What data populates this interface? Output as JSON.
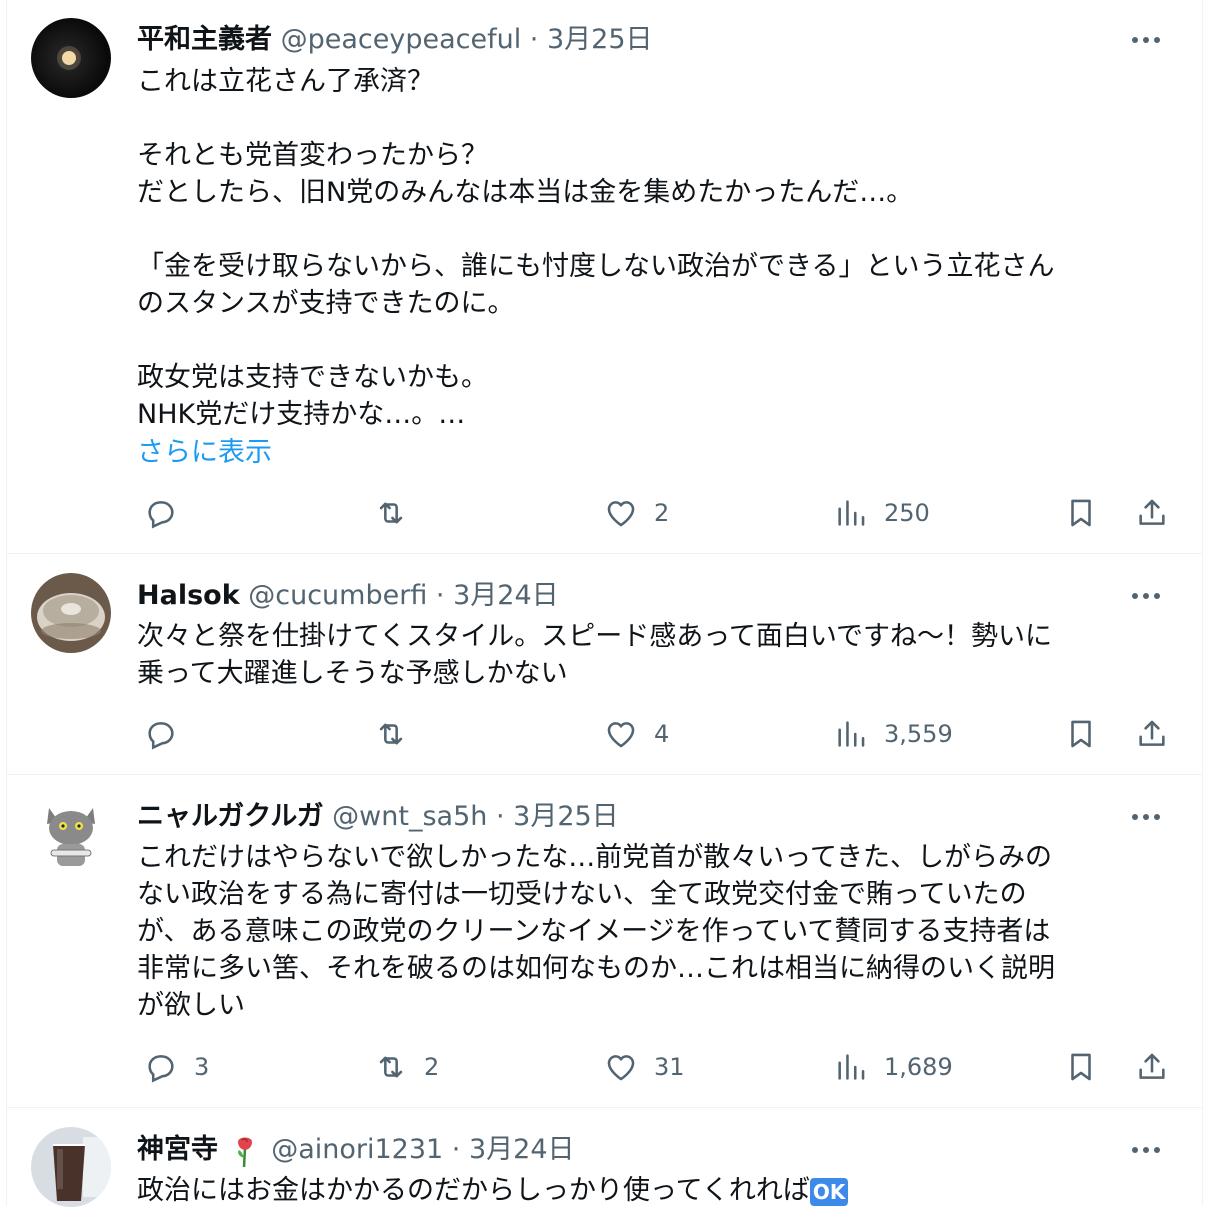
{
  "tweets": [
    {
      "name": "平和主義者",
      "handle": "@peaceypeaceful",
      "sep": "·",
      "date": "3月25日",
      "text": "これは立花さん了承済？\n\nそれとも党首変わったから？\nだとしたら、旧N党のみんなは本当は金を集めたかったんだ…。\n\n「金を受け取らないから、誰にも忖度しない政治ができる」という立花さん\nのスタンスが支持できたのに。\n\n政女党は支持できないかも。\nNHK党だけ支持かな…。…",
      "show_more": "さらに表示",
      "replies": "",
      "retweets": "",
      "likes": "2",
      "views": "250"
    },
    {
      "name": "Halsok",
      "handle": "@cucumberfi",
      "sep": "·",
      "date": "3月24日",
      "text": "次々と祭を仕掛けてくスタイル。スピード感あって面白いですね〜！勢いに\n乗って大躍進しそうな予感しかない",
      "replies": "",
      "retweets": "",
      "likes": "4",
      "views": "3,559"
    },
    {
      "name": "ニャルガクルガ",
      "handle": "@wnt_sa5h",
      "sep": "·",
      "date": "3月25日",
      "text": "これだけはやらないで欲しかったな…前党首が散々いってきた、しがらみの\nない政治をする為に寄付は一切受けない、全て政党交付金で賄っていたの\nが、ある意味この政党のクリーンなイメージを作っていて賛同する支持者は\n非常に多い筈、それを破るのは如何なものか…これは相当に納得のいく説明\nが欲しい",
      "replies": "3",
      "retweets": "2",
      "likes": "31",
      "views": "1,689"
    },
    {
      "name": "神宮寺",
      "handle": "@ainori1231",
      "sep": "·",
      "date": "3月24日",
      "text": "政治にはお金はかかるのだからしっかり使ってくれれば",
      "badge": "OK"
    }
  ],
  "colors": {
    "text": "#0f1419",
    "secondary": "#536471",
    "link": "#1d9bf0",
    "divider": "#eff3f4",
    "badge": "#3d8be8"
  },
  "icons": [
    "reply-icon",
    "retweet-icon",
    "like-icon",
    "views-icon",
    "bookmark-icon",
    "share-icon",
    "more-icon",
    "rose-emoji",
    "ok-emoji"
  ]
}
